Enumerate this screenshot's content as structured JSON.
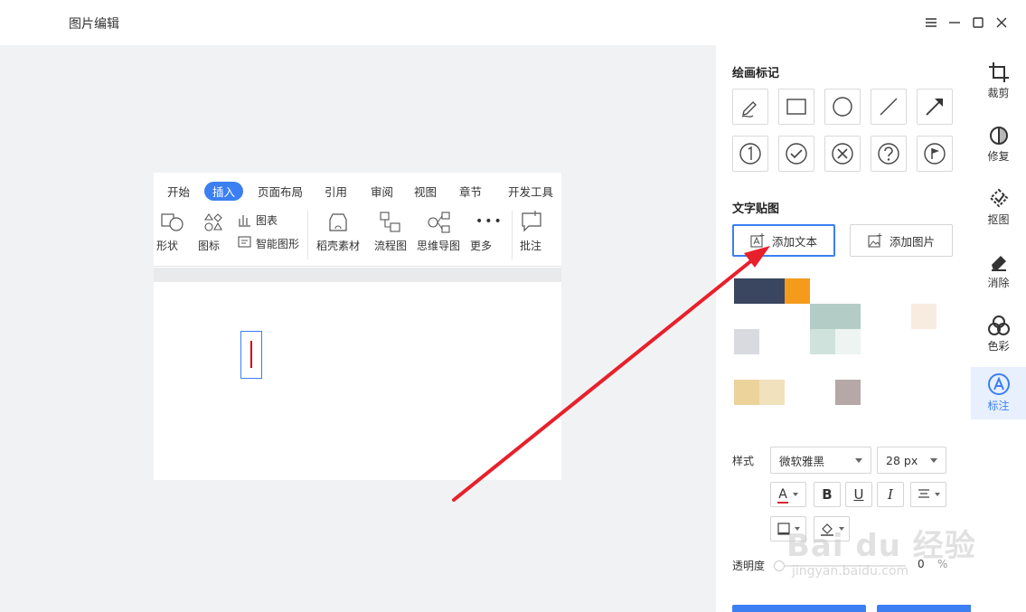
{
  "app": {
    "title": "图片编辑"
  },
  "ribbon": {
    "tabs": [
      {
        "label": "开始"
      },
      {
        "label": "插入"
      },
      {
        "label": "页面布局"
      },
      {
        "label": "引用"
      },
      {
        "label": "审阅"
      },
      {
        "label": "视图"
      },
      {
        "label": "章节"
      },
      {
        "label": "开发工具"
      }
    ],
    "active_tab": "插入",
    "tools": {
      "shape": "形状",
      "icon": "图标",
      "chart": "图表",
      "smart_shape": "智能图形",
      "material": "稻壳素材",
      "flowchart": "流程图",
      "mindmap": "思维导图",
      "more": "更多",
      "comment": "批注"
    }
  },
  "panel": {
    "drawing_title": "绘画标记",
    "drawing_tools": [
      "pen-icon",
      "rectangle-icon",
      "circle-icon",
      "line-icon",
      "arrow-icon"
    ],
    "stamp_tools": [
      "number-one-icon",
      "check-icon",
      "cross-icon",
      "question-icon",
      "flag-icon"
    ],
    "sticker_title": "文字贴图",
    "add_text": "添加文本",
    "add_image": "添加图片",
    "style_label": "样式",
    "font_family": "微软雅黑",
    "font_size": "28 px",
    "bold": "B",
    "underline": "U",
    "italic": "I",
    "font_color_glyph": "A",
    "opacity_label": "透明度",
    "opacity_value": "0",
    "opacity_unit": "%",
    "font_color": "#d9272e",
    "accent_color": "#3b7ff3"
  },
  "rail": {
    "items": [
      {
        "label": "裁剪",
        "icon": "crop-icon"
      },
      {
        "label": "修复",
        "icon": "repair-icon"
      },
      {
        "label": "抠图",
        "icon": "cutout-icon"
      },
      {
        "label": "消除",
        "icon": "eraser-icon"
      },
      {
        "label": "色彩",
        "icon": "color-icon"
      },
      {
        "label": "标注",
        "icon": "annotate-icon"
      }
    ],
    "active": "标注"
  },
  "watermark": {
    "text": "Bai du 经验",
    "url": "jingyan.baidu.com"
  }
}
